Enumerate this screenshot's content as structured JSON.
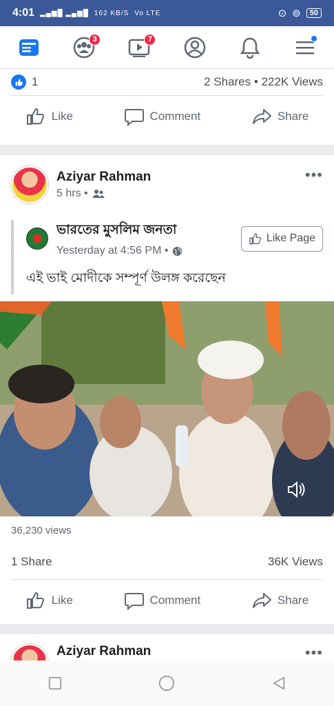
{
  "status": {
    "time": "4:01",
    "network": "162 KB/S",
    "lte": "Vo LTE",
    "battery": "50"
  },
  "nav": {
    "tabs": [
      {
        "name": "news-feed",
        "badge": ""
      },
      {
        "name": "groups",
        "badge": "3"
      },
      {
        "name": "watch",
        "badge": "7"
      },
      {
        "name": "profile",
        "badge": ""
      },
      {
        "name": "notifications",
        "badge": ""
      },
      {
        "name": "menu",
        "badge": ""
      }
    ]
  },
  "post1": {
    "reactions": "1",
    "shares_views": "2 Shares • 222K Views",
    "like_label": "Like",
    "comment_label": "Comment",
    "share_label": "Share"
  },
  "post2": {
    "author": "Aziyar Rahman",
    "time": "5 hrs •",
    "shared_page": "ভারতের মুসলিম জনতা",
    "shared_time": "Yesterday at 4:56 PM •",
    "like_page_label": "Like Page",
    "caption": "এই ভাই মোদীকে সম্পূর্ণ উলঙ্গ করেছেন",
    "video_views": "36,230 views",
    "shares": "1 Share",
    "views": "36K Views",
    "like_label": "Like",
    "comment_label": "Comment",
    "share_label": "Share"
  },
  "post3": {
    "author": "Aziyar Rahman"
  }
}
